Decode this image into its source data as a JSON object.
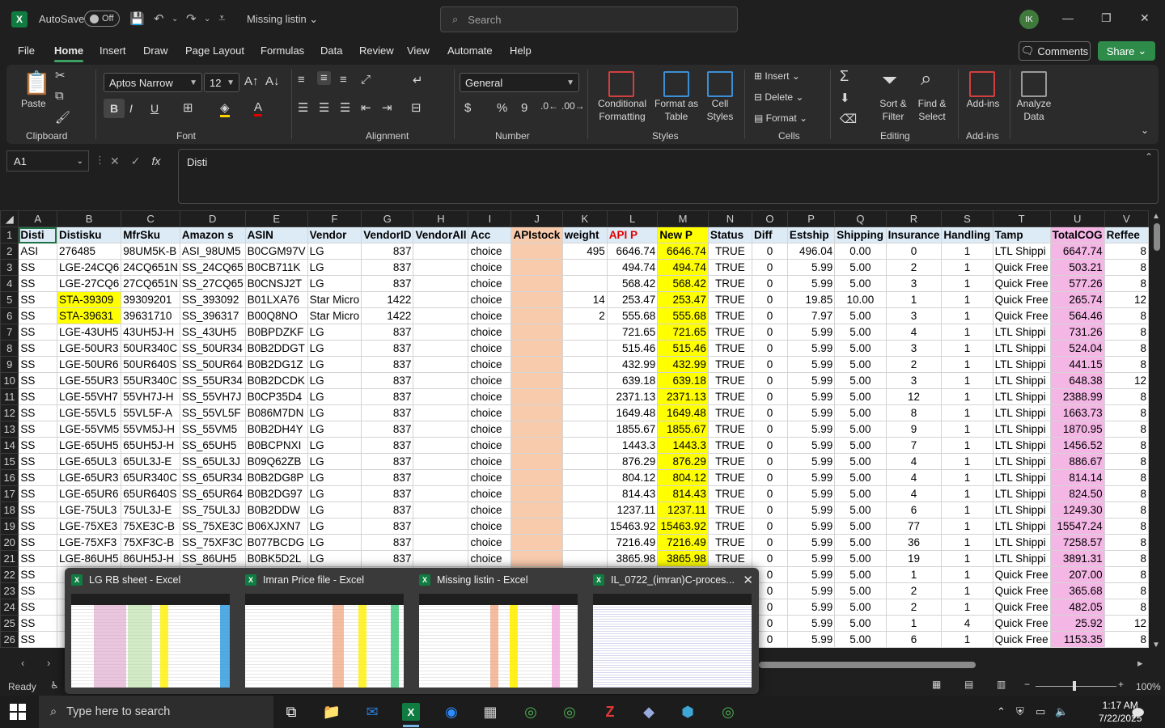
{
  "window": {
    "app_logo": "X",
    "autosave_label": "AutoSave",
    "autosave_state": "Off",
    "title": "Missing listin",
    "search_placeholder": "Search",
    "avatar_initials": "IK"
  },
  "ribbon_tabs": [
    "File",
    "Home",
    "Insert",
    "Draw",
    "Page Layout",
    "Formulas",
    "Data",
    "Review",
    "View",
    "Automate",
    "Help"
  ],
  "active_tab": "Home",
  "header_buttons": {
    "comments": "Comments",
    "share": "Share"
  },
  "ribbon": {
    "clipboard": {
      "paste": "Paste",
      "label": "Clipboard"
    },
    "font": {
      "name": "Aptos Narrow",
      "size": "12",
      "label": "Font",
      "bold": "B",
      "italic": "I",
      "underline": "U"
    },
    "alignment": {
      "label": "Alignment"
    },
    "number": {
      "format": "General",
      "label": "Number",
      "currency": "$",
      "percent": "%",
      "comma": "9"
    },
    "styles": {
      "conditional": "Conditional",
      "conditional2": "Formatting",
      "format_table": "Format as",
      "format_table2": "Table",
      "cell_styles": "Cell",
      "cell_styles2": "Styles",
      "label": "Styles"
    },
    "cells": {
      "insert": "Insert",
      "delete": "Delete",
      "format": "Format",
      "label": "Cells"
    },
    "editing": {
      "sort": "Sort &",
      "sort2": "Filter",
      "find": "Find &",
      "find2": "Select",
      "label": "Editing"
    },
    "addins": {
      "addins": "Add-ins",
      "label": "Add-ins"
    },
    "analyze": {
      "line1": "Analyze",
      "line2": "Data"
    }
  },
  "formula_bar": {
    "name_box": "A1",
    "fx": "fx",
    "content": "Disti"
  },
  "columns": [
    "A",
    "B",
    "C",
    "D",
    "E",
    "F",
    "G",
    "H",
    "I",
    "J",
    "K",
    "L",
    "M",
    "N",
    "O",
    "P",
    "Q",
    "R",
    "S",
    "T",
    "U",
    "V"
  ],
  "header_row": [
    "Disti",
    "Distisku",
    "MfrSku",
    "Amazon s",
    "ASIN",
    "Vendor",
    "VendorID",
    "VendorAll",
    "Acc",
    "APIstock",
    "weight",
    "API P",
    "New P",
    "Status",
    "Diff",
    "Estship",
    "Shipping",
    "Insurance",
    "Handling",
    "Tamp",
    "TotalCOG",
    "Reffee"
  ],
  "rows": [
    {
      "n": "2",
      "cells": [
        "ASI",
        "276485",
        "98UM5K-B",
        "ASI_98UM5",
        "B0CGM97V",
        "LG",
        "837",
        "",
        "choice",
        "",
        "495",
        "6646.74",
        "6646.74",
        "TRUE",
        "0",
        "496.04",
        "0.00",
        "0",
        "1",
        "LTL Shippi",
        "6647.74",
        "8"
      ]
    },
    {
      "n": "3",
      "cells": [
        "SS",
        "LGE-24CQ6",
        "24CQ651N",
        "SS_24CQ65",
        "B0CB711K",
        "LG",
        "837",
        "",
        "choice",
        "",
        "",
        "494.74",
        "494.74",
        "TRUE",
        "0",
        "5.99",
        "5.00",
        "2",
        "1",
        "Quick Free",
        "503.21",
        "8"
      ]
    },
    {
      "n": "4",
      "cells": [
        "SS",
        "LGE-27CQ6",
        "27CQ651N",
        "SS_27CQ65",
        "B0CNSJ2T",
        "LG",
        "837",
        "",
        "choice",
        "",
        "",
        "568.42",
        "568.42",
        "TRUE",
        "0",
        "5.99",
        "5.00",
        "3",
        "1",
        "Quick Free",
        "577.26",
        "8"
      ]
    },
    {
      "n": "5",
      "cells": [
        "SS",
        "STA-39309",
        "39309201",
        "SS_393092",
        "B01LXA76",
        "Star Micro",
        "1422",
        "",
        "choice",
        "",
        "14",
        "253.47",
        "253.47",
        "TRUE",
        "0",
        "19.85",
        "10.00",
        "1",
        "1",
        "Quick Free",
        "265.74",
        "12"
      ]
    },
    {
      "n": "6",
      "cells": [
        "SS",
        "STA-39631",
        "39631710",
        "SS_396317",
        "B00Q8NO",
        "Star Micro",
        "1422",
        "",
        "choice",
        "",
        "2",
        "555.68",
        "555.68",
        "TRUE",
        "0",
        "7.97",
        "5.00",
        "3",
        "1",
        "Quick Free",
        "564.46",
        "8"
      ]
    },
    {
      "n": "7",
      "cells": [
        "SS",
        "LGE-43UH5",
        "43UH5J-H",
        "SS_43UH5",
        "B0BPDZKF",
        "LG",
        "837",
        "",
        "choice",
        "",
        "",
        "721.65",
        "721.65",
        "TRUE",
        "0",
        "5.99",
        "5.00",
        "4",
        "1",
        "LTL Shippi",
        "731.26",
        "8"
      ]
    },
    {
      "n": "8",
      "cells": [
        "SS",
        "LGE-50UR3",
        "50UR340C",
        "SS_50UR34",
        "B0B2DDGT",
        "LG",
        "837",
        "",
        "choice",
        "",
        "",
        "515.46",
        "515.46",
        "TRUE",
        "0",
        "5.99",
        "5.00",
        "3",
        "1",
        "LTL Shippi",
        "524.04",
        "8"
      ]
    },
    {
      "n": "9",
      "cells": [
        "SS",
        "LGE-50UR6",
        "50UR640S",
        "SS_50UR64",
        "B0B2DG1Z",
        "LG",
        "837",
        "",
        "choice",
        "",
        "",
        "432.99",
        "432.99",
        "TRUE",
        "0",
        "5.99",
        "5.00",
        "2",
        "1",
        "LTL Shippi",
        "441.15",
        "8"
      ]
    },
    {
      "n": "10",
      "cells": [
        "SS",
        "LGE-55UR3",
        "55UR340C",
        "SS_55UR34",
        "B0B2DCDK",
        "LG",
        "837",
        "",
        "choice",
        "",
        "",
        "639.18",
        "639.18",
        "TRUE",
        "0",
        "5.99",
        "5.00",
        "3",
        "1",
        "LTL Shippi",
        "648.38",
        "12"
      ]
    },
    {
      "n": "11",
      "cells": [
        "SS",
        "LGE-55VH7",
        "55VH7J-H",
        "SS_55VH7J",
        "B0CP35D4",
        "LG",
        "837",
        "",
        "choice",
        "",
        "",
        "2371.13",
        "2371.13",
        "TRUE",
        "0",
        "5.99",
        "5.00",
        "12",
        "1",
        "LTL Shippi",
        "2388.99",
        "8"
      ]
    },
    {
      "n": "12",
      "cells": [
        "SS",
        "LGE-55VL5",
        "55VL5F-A",
        "SS_55VL5F",
        "B086M7DN",
        "LG",
        "837",
        "",
        "choice",
        "",
        "",
        "1649.48",
        "1649.48",
        "TRUE",
        "0",
        "5.99",
        "5.00",
        "8",
        "1",
        "LTL Shippi",
        "1663.73",
        "8"
      ]
    },
    {
      "n": "13",
      "cells": [
        "SS",
        "LGE-55VM5",
        "55VM5J-H",
        "SS_55VM5",
        "B0B2DH4Y",
        "LG",
        "837",
        "",
        "choice",
        "",
        "",
        "1855.67",
        "1855.67",
        "TRUE",
        "0",
        "5.99",
        "5.00",
        "9",
        "1",
        "LTL Shippi",
        "1870.95",
        "8"
      ]
    },
    {
      "n": "14",
      "cells": [
        "SS",
        "LGE-65UH5",
        "65UH5J-H",
        "SS_65UH5",
        "B0BCPNXI",
        "LG",
        "837",
        "",
        "choice",
        "",
        "",
        "1443.3",
        "1443.3",
        "TRUE",
        "0",
        "5.99",
        "5.00",
        "7",
        "1",
        "LTL Shippi",
        "1456.52",
        "8"
      ]
    },
    {
      "n": "15",
      "cells": [
        "SS",
        "LGE-65UL3",
        "65UL3J-E",
        "SS_65UL3J",
        "B09Q62ZB",
        "LG",
        "837",
        "",
        "choice",
        "",
        "",
        "876.29",
        "876.29",
        "TRUE",
        "0",
        "5.99",
        "5.00",
        "4",
        "1",
        "LTL Shippi",
        "886.67",
        "8"
      ]
    },
    {
      "n": "16",
      "cells": [
        "SS",
        "LGE-65UR3",
        "65UR340C",
        "SS_65UR34",
        "B0B2DG8P",
        "LG",
        "837",
        "",
        "choice",
        "",
        "",
        "804.12",
        "804.12",
        "TRUE",
        "0",
        "5.99",
        "5.00",
        "4",
        "1",
        "LTL Shippi",
        "814.14",
        "8"
      ]
    },
    {
      "n": "17",
      "cells": [
        "SS",
        "LGE-65UR6",
        "65UR640S",
        "SS_65UR64",
        "B0B2DG97",
        "LG",
        "837",
        "",
        "choice",
        "",
        "",
        "814.43",
        "814.43",
        "TRUE",
        "0",
        "5.99",
        "5.00",
        "4",
        "1",
        "LTL Shippi",
        "824.50",
        "8"
      ]
    },
    {
      "n": "18",
      "cells": [
        "SS",
        "LGE-75UL3",
        "75UL3J-E",
        "SS_75UL3J",
        "B0B2DDW",
        "LG",
        "837",
        "",
        "choice",
        "",
        "",
        "1237.11",
        "1237.11",
        "TRUE",
        "0",
        "5.99",
        "5.00",
        "6",
        "1",
        "LTL Shippi",
        "1249.30",
        "8"
      ]
    },
    {
      "n": "19",
      "cells": [
        "SS",
        "LGE-75XE3",
        "75XE3C-B",
        "SS_75XE3C",
        "B06XJXN7",
        "LG",
        "837",
        "",
        "choice",
        "",
        "",
        "15463.92",
        "15463.92",
        "TRUE",
        "0",
        "5.99",
        "5.00",
        "77",
        "1",
        "LTL Shippi",
        "15547.24",
        "8"
      ]
    },
    {
      "n": "20",
      "cells": [
        "SS",
        "LGE-75XF3",
        "75XF3C-B",
        "SS_75XF3C",
        "B077BCDG",
        "LG",
        "837",
        "",
        "choice",
        "",
        "",
        "7216.49",
        "7216.49",
        "TRUE",
        "0",
        "5.99",
        "5.00",
        "36",
        "1",
        "LTL Shippi",
        "7258.57",
        "8"
      ]
    },
    {
      "n": "21",
      "cells": [
        "SS",
        "LGE-86UH5",
        "86UH5J-H",
        "SS_86UH5",
        "B0BK5D2L",
        "LG",
        "837",
        "",
        "choice",
        "",
        "",
        "3865.98",
        "3865.98",
        "TRUE",
        "0",
        "5.99",
        "5.00",
        "19",
        "1",
        "LTL Shippi",
        "3891.31",
        "8"
      ]
    },
    {
      "n": "22",
      "cells": [
        "SS",
        "",
        "",
        "",
        "",
        "",
        "",
        "",
        "",
        "",
        "",
        "",
        "",
        "",
        "0",
        "5.99",
        "5.00",
        "1",
        "1",
        "Quick Free",
        "207.00",
        "8"
      ]
    },
    {
      "n": "23",
      "cells": [
        "SS",
        "",
        "",
        "",
        "",
        "",
        "",
        "",
        "",
        "",
        "",
        "",
        "",
        "",
        "0",
        "5.99",
        "5.00",
        "2",
        "1",
        "Quick Free",
        "365.68",
        "8"
      ]
    },
    {
      "n": "24",
      "cells": [
        "SS",
        "",
        "",
        "",
        "",
        "",
        "",
        "",
        "",
        "",
        "",
        "",
        "",
        "",
        "0",
        "5.99",
        "5.00",
        "2",
        "1",
        "Quick Free",
        "482.05",
        "8"
      ]
    },
    {
      "n": "25",
      "cells": [
        "SS",
        "",
        "",
        "",
        "",
        "",
        "",
        "",
        "",
        "",
        "",
        "",
        "",
        "",
        "0",
        "5.99",
        "5.00",
        "1",
        "4",
        "Quick Free",
        "25.92",
        "12"
      ]
    },
    {
      "n": "26",
      "cells": [
        "SS",
        "",
        "",
        "",
        "",
        "",
        "",
        "",
        "",
        "",
        "",
        "",
        "",
        "",
        "0",
        "5.99",
        "5.00",
        "6",
        "1",
        "Quick Free",
        "1153.35",
        "8"
      ]
    }
  ],
  "status": {
    "ready": "Ready",
    "zoom": "100%"
  },
  "thumbnails": [
    {
      "title": "LG RB sheet - Excel"
    },
    {
      "title": "Imran Price file - Excel"
    },
    {
      "title": "Missing listin - Excel"
    },
    {
      "title": "IL_0722_(imran)C-proces..."
    }
  ],
  "taskbar": {
    "search_placeholder": "Type here to search",
    "time": "1:17 AM",
    "date": "7/22/2025"
  },
  "colors": {
    "excel_green": "#107c41",
    "header_fill": "#ddebf7",
    "yellow": "#ffff00",
    "peach": "#f8cbad",
    "pink": "#f4b6e5",
    "red_text": "#e00000"
  }
}
